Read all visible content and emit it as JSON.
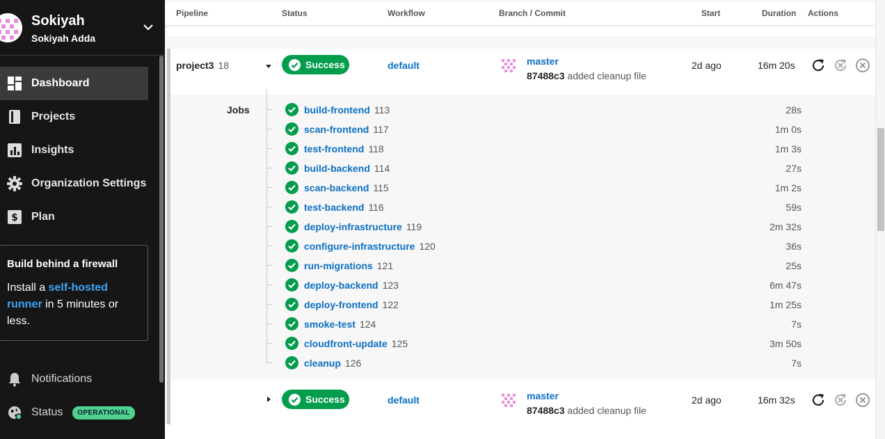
{
  "sidebar": {
    "org_name": "Sokiyah",
    "user_name": "Sokiyah Adda",
    "nav": [
      {
        "label": "Dashboard",
        "icon": "dashboard-icon",
        "active": true
      },
      {
        "label": "Projects",
        "icon": "book-icon",
        "active": false
      },
      {
        "label": "Insights",
        "icon": "bar-chart-icon",
        "active": false
      },
      {
        "label": "Organization Settings",
        "icon": "gear-icon",
        "active": false
      },
      {
        "label": "Plan",
        "icon": "dollar-icon",
        "active": false
      }
    ],
    "promo": {
      "title": "Build behind a firewall",
      "text_before": "Install a ",
      "link": "self-hosted runner",
      "text_after": " in 5 minutes or less."
    },
    "notifications_label": "Notifications",
    "status_label": "Status",
    "status_badge": "OPERATIONAL"
  },
  "table": {
    "headers": {
      "pipeline": "Pipeline",
      "status": "Status",
      "workflow": "Workflow",
      "branch_commit": "Branch / Commit",
      "start": "Start",
      "duration": "Duration",
      "actions": "Actions"
    }
  },
  "pipelines": [
    {
      "project": "project3",
      "number": "18",
      "status": "Success",
      "workflow": "default",
      "branch": "master",
      "commit_hash": "87488c3",
      "commit_msg": "added cleanup file",
      "start": "2d ago",
      "duration": "16m 20s",
      "expanded": true
    },
    {
      "project": "",
      "number": "",
      "status": "Success",
      "workflow": "default",
      "branch": "master",
      "commit_hash": "87488c3",
      "commit_msg": "added cleanup file",
      "start": "2d ago",
      "duration": "16m 32s",
      "expanded": false
    }
  ],
  "jobs_label": "Jobs",
  "jobs": [
    {
      "name": "build-frontend",
      "number": "113",
      "duration": "28s"
    },
    {
      "name": "scan-frontend",
      "number": "117",
      "duration": "1m 0s"
    },
    {
      "name": "test-frontend",
      "number": "118",
      "duration": "1m 3s"
    },
    {
      "name": "build-backend",
      "number": "114",
      "duration": "27s"
    },
    {
      "name": "scan-backend",
      "number": "115",
      "duration": "1m 2s"
    },
    {
      "name": "test-backend",
      "number": "116",
      "duration": "59s"
    },
    {
      "name": "deploy-infrastructure",
      "number": "119",
      "duration": "2m 32s"
    },
    {
      "name": "configure-infrastructure",
      "number": "120",
      "duration": "36s"
    },
    {
      "name": "run-migrations",
      "number": "121",
      "duration": "25s"
    },
    {
      "name": "deploy-backend",
      "number": "123",
      "duration": "6m 47s"
    },
    {
      "name": "deploy-frontend",
      "number": "122",
      "duration": "1m 25s"
    },
    {
      "name": "smoke-test",
      "number": "124",
      "duration": "7s"
    },
    {
      "name": "cloudfront-update",
      "number": "125",
      "duration": "3m 50s"
    },
    {
      "name": "cleanup",
      "number": "126",
      "duration": "7s"
    }
  ],
  "colors": {
    "success": "#039d4d",
    "link": "#0b6fc3",
    "sidebar_bg": "#161616",
    "status_badge": "#4ed08e"
  }
}
